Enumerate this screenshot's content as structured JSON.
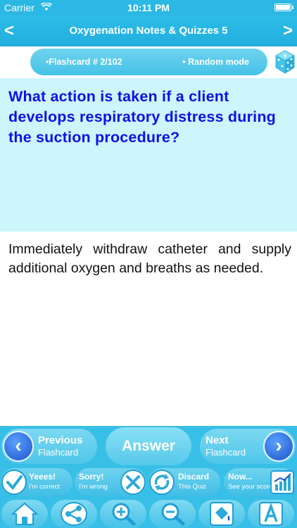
{
  "status_bar": {
    "carrier": "Carrier",
    "time": "10:11 PM"
  },
  "header": {
    "title": "Oxygenation Notes & Quizzes 5",
    "back_glyph": "<",
    "forward_glyph": ">"
  },
  "flashcard_bar": {
    "counter": "•Flashcard #  2/102",
    "mode": "• Random mode"
  },
  "question": "What action is taken if a client develops respiratory distress during the suction procedure?",
  "answer": "Immediately withdraw catheter and supply additional oxygen and breaths as needed.",
  "nav_buttons": {
    "previous": {
      "line1": "Previous",
      "line2": "Flashcard"
    },
    "answer": "Answer",
    "next": {
      "line1": "Next",
      "line2": "Flashcard"
    }
  },
  "score_buttons": [
    {
      "line1": "Yeees!",
      "line2": "I'm correct",
      "icon": "check-icon"
    },
    {
      "line1": "Sorry!",
      "line2": "I'm wrong",
      "icon": "x-icon"
    },
    {
      "line1": "Discard",
      "line2": "This Quiz",
      "icon": "recycle-icon"
    },
    {
      "line1": "Now...",
      "line2": "See your score",
      "icon": "bar-chart-icon"
    }
  ],
  "toolbar_icons": [
    "home-icon",
    "share-icon",
    "zoom-in-icon",
    "zoom-out-icon",
    "paint-bucket-icon",
    "font-icon"
  ],
  "colors": {
    "accent": "#2bb8e4",
    "question_bg": "#ccf6fc",
    "question_text": "#1010e6",
    "panel": "#38bfe7"
  }
}
